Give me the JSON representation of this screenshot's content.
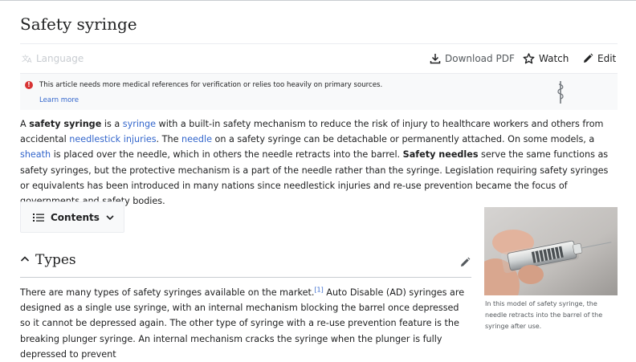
{
  "title": "Safety syringe",
  "toolbar": {
    "language": "Language",
    "download_pdf": "Download PDF",
    "watch": "Watch",
    "edit": "Edit"
  },
  "notice": {
    "text": "This article needs more medical references for verification or relies too heavily on primary sources.",
    "link": "Learn more"
  },
  "intro": {
    "s1": "A ",
    "b1": "safety syringe",
    "s2": " is a ",
    "l_syringe": "syringe",
    "s3": " with a built-in safety mechanism to reduce the risk of injury to healthcare workers and others from accidental ",
    "l_needlestick": "needlestick injuries",
    "s4": ". The ",
    "l_needle": "needle",
    "s5": " on a safety syringe can be detachable or permanently attached. On some models, a ",
    "l_sheath": "sheath",
    "s6": " is placed over the needle, which in others the needle retracts into the barrel. ",
    "b2": "Safety needles",
    "s7": " serve the same functions as safety syringes, but the protective mechanism is a part of the needle rather than the syringe. Legislation requiring safety syringes or equivalents has been introduced in many nations since needlestick injuries and re-use prevention became the focus of governments and safety bodies."
  },
  "contents_label": "Contents",
  "section": {
    "title": "Types"
  },
  "types": {
    "s1": "There are many types of safety syringes available on the market.",
    "ref": "[1]",
    "s2": " Auto Disable (AD) syringes are designed as a single use syringe, with an internal mechanism blocking the barrel once depressed so it cannot be depressed again. The other type of syringe with a re-use prevention feature is the breaking plunger syringe. An internal mechanism cracks the syringe when the plunger is fully depressed to prevent"
  },
  "figure": {
    "caption": "In this model of safety syringe, the needle retracts into the barrel of the syringe after use."
  },
  "icons": {
    "language": "translate-icon",
    "download": "download-icon",
    "watch": "star-icon",
    "edit": "pencil-icon",
    "notice": "exclamation-icon",
    "medical": "rod-of-asclepius-icon",
    "contents": "list-icon",
    "chevron": "chevron-down-icon",
    "section": "chevron-up-icon"
  },
  "colors": {
    "link": "#3366cc",
    "notice_icon": "#d73333"
  }
}
